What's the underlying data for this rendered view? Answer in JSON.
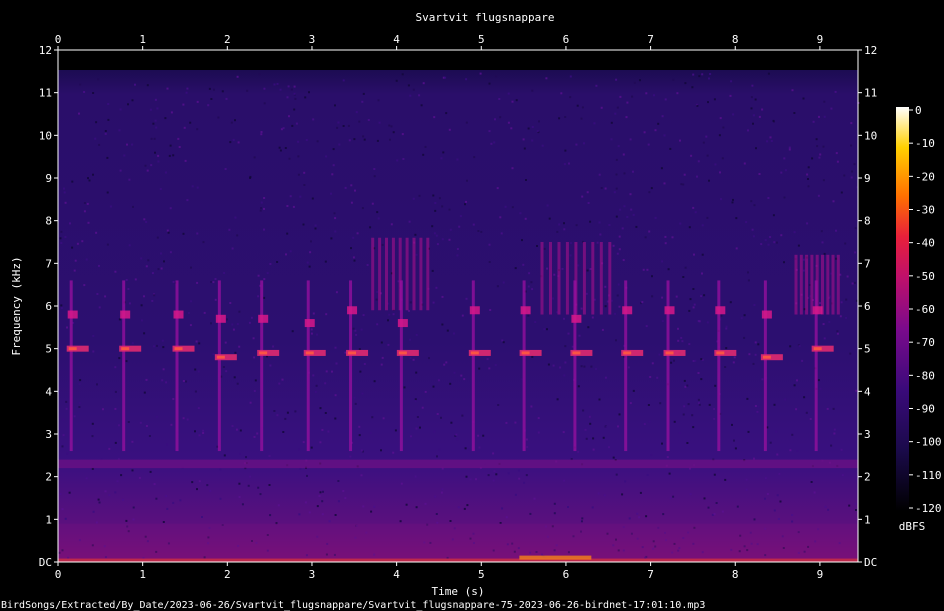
{
  "chart_data": {
    "type": "heatmap",
    "title": "Svartvit flugsnappare",
    "xlabel": "Time (s)",
    "ylabel": "Frequency (kHz)",
    "xlim": [
      0,
      9.45
    ],
    "ylim": [
      0,
      12
    ],
    "x_ticks": [
      "0",
      "1",
      "2",
      "3",
      "4",
      "5",
      "6",
      "7",
      "8",
      "9"
    ],
    "y_ticks": [
      "DC",
      "1",
      "2",
      "3",
      "4",
      "5",
      "6",
      "7",
      "8",
      "9",
      "10",
      "11",
      "12"
    ],
    "colorbar": {
      "label": "dBFS",
      "ticks": [
        "0",
        "-10",
        "-20",
        "-30",
        "-40",
        "-50",
        "-60",
        "-70",
        "-80",
        "-90",
        "-100",
        "-110",
        "-120"
      ],
      "range": [
        -120,
        0
      ],
      "colors": [
        "#000000",
        "#1a0a4a",
        "#5a0a8c",
        "#b0107a",
        "#e0203a",
        "#ff7000",
        "#ffd000",
        "#ffffff"
      ]
    },
    "background_level_dbfs": -100,
    "noise_band_khz": [
      2.2,
      2.4
    ],
    "calls": [
      {
        "t": 0.15,
        "main_khz": 5.0,
        "upper_khz": 5.8
      },
      {
        "t": 0.77,
        "main_khz": 5.0,
        "upper_khz": 5.8
      },
      {
        "t": 1.4,
        "main_khz": 5.0,
        "upper_khz": 5.8
      },
      {
        "t": 1.9,
        "main_khz": 4.8,
        "upper_khz": 5.7
      },
      {
        "t": 2.4,
        "main_khz": 4.9,
        "upper_khz": 5.7
      },
      {
        "t": 2.95,
        "main_khz": 4.9,
        "upper_khz": 5.6
      },
      {
        "t": 3.45,
        "main_khz": 4.9,
        "upper_khz": 5.9
      },
      {
        "t": 4.05,
        "main_khz": 4.9,
        "upper_khz": 5.6
      },
      {
        "t": 4.9,
        "main_khz": 4.9,
        "upper_khz": 5.9
      },
      {
        "t": 5.5,
        "main_khz": 4.9,
        "upper_khz": 5.9
      },
      {
        "t": 6.1,
        "main_khz": 4.9,
        "upper_khz": 5.7
      },
      {
        "t": 6.7,
        "main_khz": 4.9,
        "upper_khz": 5.9
      },
      {
        "t": 7.2,
        "main_khz": 4.9,
        "upper_khz": 5.9
      },
      {
        "t": 7.8,
        "main_khz": 4.9,
        "upper_khz": 5.9
      },
      {
        "t": 8.35,
        "main_khz": 4.8,
        "upper_khz": 5.8
      },
      {
        "t": 8.95,
        "main_khz": 5.0,
        "upper_khz": 5.9
      }
    ],
    "harmonic_clusters": [
      {
        "t_start": 3.7,
        "t_end": 4.35,
        "khz_low": 5.9,
        "khz_high": 7.6
      },
      {
        "t_start": 5.7,
        "t_end": 6.5,
        "khz_low": 5.8,
        "khz_high": 7.5
      },
      {
        "t_start": 8.7,
        "t_end": 9.2,
        "khz_low": 5.8,
        "khz_high": 7.2
      }
    ]
  },
  "footer_path": "BirdSongs/Extracted/By_Date/2023-06-26/Svartvit_flugsnappare/Svartvit_flugsnappare-75-2023-06-26-birdnet-17:01:10.mp3"
}
